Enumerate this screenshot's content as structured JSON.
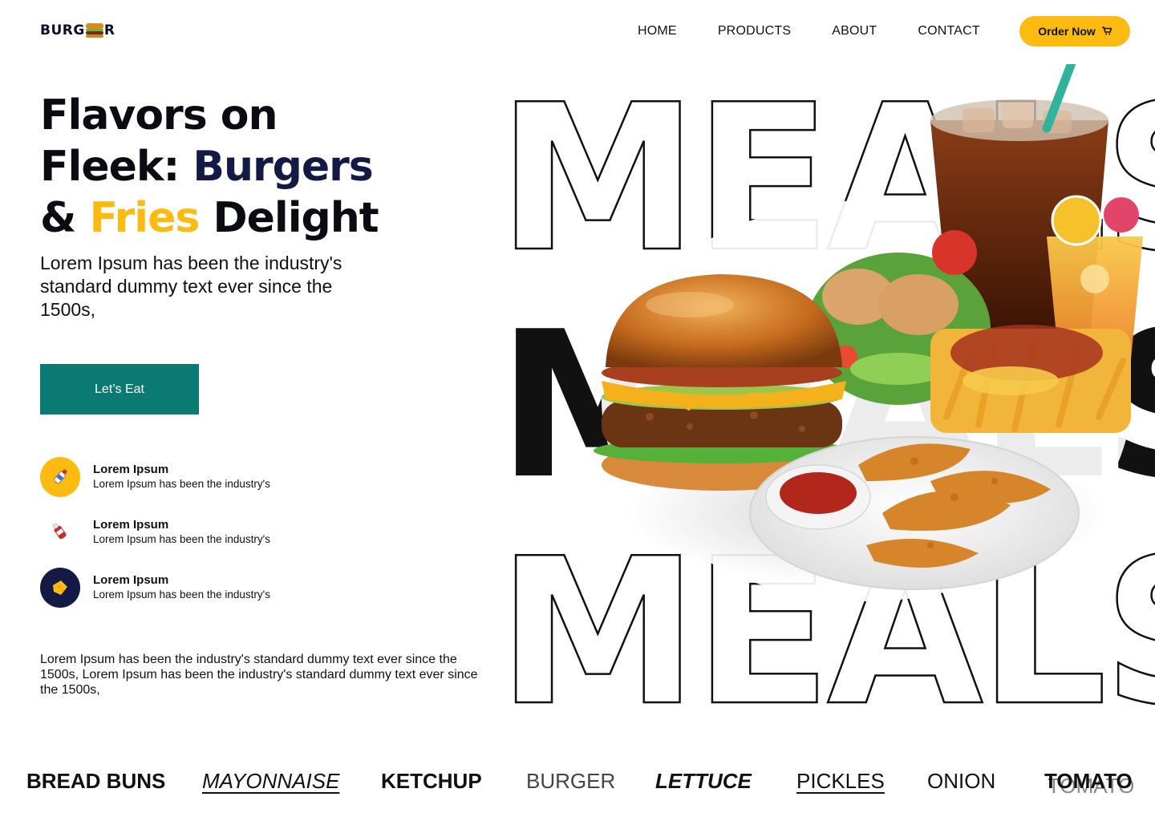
{
  "brand": {
    "name_prefix": "BURG",
    "name_suffix": "R"
  },
  "nav": {
    "items": [
      {
        "label": "HOME"
      },
      {
        "label": "PRODUCTS"
      },
      {
        "label": "ABOUT"
      },
      {
        "label": "CONTACT"
      }
    ],
    "order_label": "Order Now",
    "order_icon": "cart-icon"
  },
  "hero": {
    "title": {
      "line1": "Flavors on",
      "line2_a": "Fleek: ",
      "line2_b": "Burgers",
      "line3_a": "& ",
      "line3_b": "Fries",
      "line3_c": " Delight"
    },
    "subtitle": "Lorem Ipsum has been the industry's standard dummy text ever since the 1500s,",
    "cta_label": "Let’s Eat",
    "features": [
      {
        "title": "Lorem Ipsum",
        "desc": "Lorem Ipsum has been the industry's",
        "icon": "sauce-bottle-icon",
        "bg": "#fdbb11"
      },
      {
        "title": "Lorem Ipsum",
        "desc": "Lorem Ipsum has been the industry's",
        "icon": "ketchup-icon",
        "bg": "#ffffff"
      },
      {
        "title": "Lorem Ipsum",
        "desc": "Lorem Ipsum has been the industry's",
        "icon": "cheese-icon",
        "bg": "#131a46"
      }
    ],
    "body": "Lorem Ipsum has been the industry's standard dummy text ever since the 1500s, Lorem Ipsum has been the industry's standard dummy text ever since the 1500s,"
  },
  "visual": {
    "word": "MEALS"
  },
  "ingredients": [
    {
      "label": "BREAD BUNS"
    },
    {
      "label": "MAYONNAISE"
    },
    {
      "label": "KETCHUP"
    },
    {
      "label": "BURGER"
    },
    {
      "label": "LETTUCE"
    },
    {
      "label": "PICKLES"
    },
    {
      "label": "ONION"
    },
    {
      "label": "TOMATO"
    }
  ],
  "colors": {
    "accent": "#fdbb11",
    "navy": "#131a46",
    "teal": "#0a7a72"
  }
}
